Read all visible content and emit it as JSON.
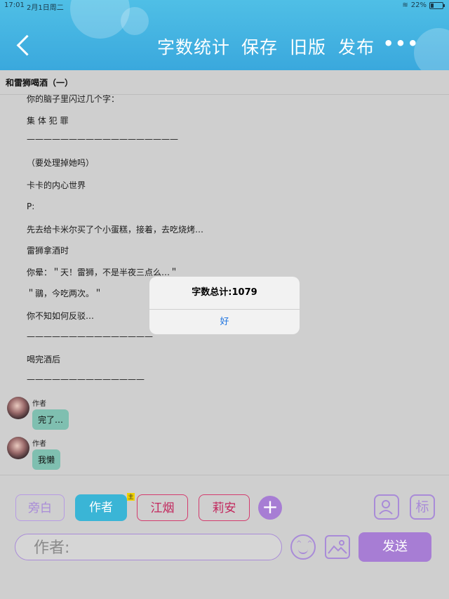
{
  "status": {
    "time": "17:01",
    "date": "2月1日周二",
    "battery": "22%"
  },
  "header": {
    "buttons": [
      "字数统计",
      "保存",
      "旧版",
      "发布"
    ],
    "more": "•••"
  },
  "doc_title": "和雷狮喝酒（一）",
  "lines": [
    "你的脑子里闪过几个字：",
    "集 体 犯 罪",
    "——————————————————",
    "（要处理掉她吗）",
    "卡卡的内心世界",
    "P:",
    "先去给卡米尔买了个小蛋糕，接着，去吃烧烤…",
    "雷狮拿酒时",
    "你晕：＂天！雷狮，不是半夜三点么…＂",
    "＂鶸，今吃两次。＂",
    "你不知如何反驳…",
    "———————————————",
    "喝完酒后",
    "——————————————"
  ],
  "chat": [
    {
      "role": "作者",
      "text": "完了…"
    },
    {
      "role": "作者",
      "text": "我懒"
    }
  ],
  "dialog": {
    "message": "字数总计:1079",
    "ok": "好"
  },
  "roles": {
    "narrator": "旁白",
    "author": "作者",
    "main_badge": "主",
    "char1": "江烟",
    "char2": "莉安",
    "add": "+"
  },
  "tools": {
    "contacts_icon": "user-card-icon",
    "tag_label": "标"
  },
  "input": {
    "placeholder": "作者:"
  },
  "send_label": "发送"
}
